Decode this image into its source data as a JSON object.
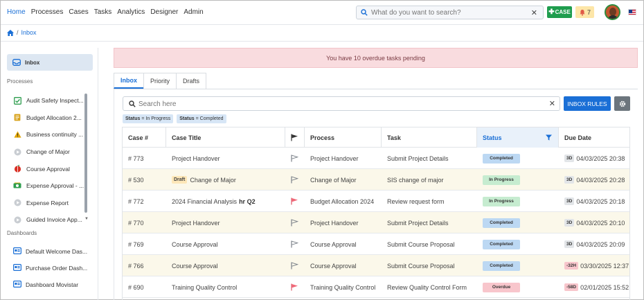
{
  "nav": {
    "items": [
      "Home",
      "Processes",
      "Cases",
      "Tasks",
      "Analytics",
      "Designer",
      "Admin"
    ],
    "active": "Home"
  },
  "search_top": {
    "placeholder": "What do you want to search?",
    "clear": "✕"
  },
  "case_button": "CASE",
  "notifications": "7",
  "breadcrumb": {
    "current": "Inbox",
    "sep": "/"
  },
  "sidebar": {
    "inbox_label": "Inbox",
    "processes_label": "Processes",
    "processes": [
      {
        "label": "Audit Safety Inspect...",
        "icon": "check-square-icon",
        "color": "#2e9e4f"
      },
      {
        "label": "Budget Allocation 2...",
        "icon": "document-icon",
        "color": "#d8a21b"
      },
      {
        "label": "Business continuity ...",
        "icon": "warning-icon",
        "color": "#e0a400"
      },
      {
        "label": "Change of Major",
        "icon": "play-circle-icon",
        "color": "#9aa0a6"
      },
      {
        "label": "Course Approval",
        "icon": "apple-icon",
        "color": "#d93025"
      },
      {
        "label": "Expense Approval - ...",
        "icon": "money-icon",
        "color": "#2e9e4f"
      },
      {
        "label": "Expense Report",
        "icon": "play-circle-icon",
        "color": "#9aa0a6"
      },
      {
        "label": "Guided Invoice App...",
        "icon": "play-circle-icon",
        "color": "#9aa0a6"
      }
    ],
    "dashboards_label": "Dashboards",
    "dashboards": [
      "Default Welcome Das...",
      "Purchase Order Dash...",
      "Dashboard Movistar"
    ]
  },
  "alert": "You have 10 overdue tasks pending",
  "tabs": [
    "Inbox",
    "Priority",
    "Drafts"
  ],
  "search_main": {
    "placeholder": "Search here",
    "clear": "✕"
  },
  "inbox_rules": "INBOX RULES",
  "filters": [
    {
      "key": "Status",
      "value": "= In Progress"
    },
    {
      "key": "Status",
      "value": "= Completed"
    }
  ],
  "table": {
    "headers": {
      "case": "Case #",
      "title": "Case Title",
      "process": "Process",
      "task": "Task",
      "status": "Status",
      "due": "Due Date"
    },
    "rows": [
      {
        "case": "# 773",
        "title": "Project Handover",
        "draft": "",
        "extra": "",
        "flag": "outline",
        "process": "Project Handover",
        "task": "Submit Project Details",
        "status": "Completed",
        "status_kind": "completed",
        "due_tag": "3D",
        "due_neg": false,
        "due": "04/03/2025 20:38"
      },
      {
        "case": "# 530",
        "title": "Change of Major",
        "draft": "Draft",
        "extra": "",
        "flag": "outline",
        "process": "Change of Major",
        "task": "SIS change of major",
        "status": "In Progress",
        "status_kind": "inprogress",
        "due_tag": "3D",
        "due_neg": false,
        "due": "04/03/2025 20:28"
      },
      {
        "case": "# 772",
        "title": "2024 Financial Analysis",
        "draft": "",
        "extra": "hr Q2",
        "flag": "red",
        "process": "Budget Allocation 2024",
        "task": "Review request form",
        "status": "In Progress",
        "status_kind": "inprogress",
        "due_tag": "3D",
        "due_neg": false,
        "due": "04/03/2025 20:18"
      },
      {
        "case": "# 770",
        "title": "Project Handover",
        "draft": "",
        "extra": "",
        "flag": "outline",
        "process": "Project Handover",
        "task": "Submit Project Details",
        "status": "Completed",
        "status_kind": "completed",
        "due_tag": "3D",
        "due_neg": false,
        "due": "04/03/2025 20:10"
      },
      {
        "case": "# 769",
        "title": "Course Approval",
        "draft": "",
        "extra": "",
        "flag": "outline",
        "process": "Course Approval",
        "task": "Submit Course Proposal",
        "status": "Completed",
        "status_kind": "completed",
        "due_tag": "3D",
        "due_neg": false,
        "due": "04/03/2025 20:09"
      },
      {
        "case": "# 766",
        "title": "Course Approval",
        "draft": "",
        "extra": "",
        "flag": "outline",
        "process": "Course Approval",
        "task": "Submit Course Proposal",
        "status": "Completed",
        "status_kind": "completed",
        "due_tag": "-32H",
        "due_neg": true,
        "due": "03/30/2025 12:37"
      },
      {
        "case": "# 690",
        "title": "Training Quality Control",
        "draft": "",
        "extra": "",
        "flag": "red",
        "process": "Training Quality Control",
        "task": "Review Quality Control Form",
        "status": "Overdue",
        "status_kind": "overdue",
        "due_tag": "-58D",
        "due_neg": true,
        "due": "02/01/2025 15:52"
      }
    ]
  }
}
